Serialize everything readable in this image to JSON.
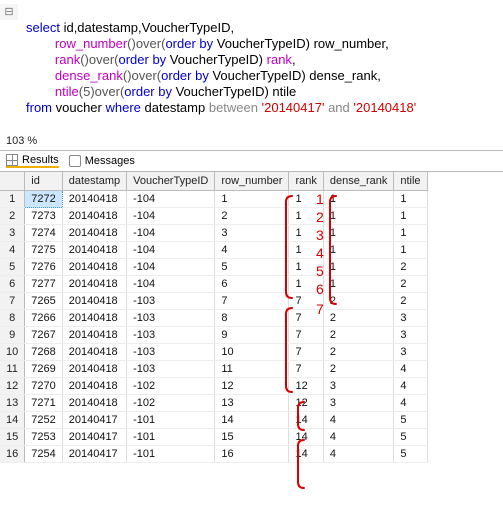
{
  "editor": {
    "toggle": "⊟",
    "line1_a": "select",
    "line1_b": " id,datestamp,VoucherTypeID,",
    "line2_a": "        ",
    "line2_b": "row_number",
    "line2_c": "()over(",
    "line2_d": "order by",
    "line2_e": " VoucherTypeID) row_number,",
    "line3_a": "        ",
    "line3_b": "rank",
    "line3_c": "()over(",
    "line3_d": "order by",
    "line3_e": " VoucherTypeID) ",
    "line3_f": "rank",
    "line3_g": ",",
    "line4_a": "        ",
    "line4_b": "dense_rank",
    "line4_c": "()over(",
    "line4_d": "order by",
    "line4_e": " VoucherTypeID) dense_rank,",
    "line5_a": "        ",
    "line5_b": "ntile",
    "line5_c": "(5)over(",
    "line5_d": "order by",
    "line5_e": " VoucherTypeID) ntile",
    "line6_a": "from",
    "line6_b": " voucher ",
    "line6_c": "where",
    "line6_d": " datestamp ",
    "line6_e": "between",
    "line6_f": " ",
    "line6_g": "'20140417'",
    "line6_h": " ",
    "line6_i": "and",
    "line6_j": " ",
    "line6_k": "'20140418'"
  },
  "zoom": "103 %",
  "tabs": {
    "results": "Results",
    "messages": "Messages"
  },
  "columns": [
    "",
    "id",
    "datestamp",
    "VoucherTypeID",
    "row_number",
    "rank",
    "dense_rank",
    "ntile"
  ],
  "rows": [
    {
      "n": "1",
      "id": "7272",
      "ds": "20140418",
      "vt": "-104",
      "rn": "1",
      "rk": "1",
      "dr": "1",
      "nt": "1"
    },
    {
      "n": "2",
      "id": "7273",
      "ds": "20140418",
      "vt": "-104",
      "rn": "2",
      "rk": "1",
      "dr": "1",
      "nt": "1"
    },
    {
      "n": "3",
      "id": "7274",
      "ds": "20140418",
      "vt": "-104",
      "rn": "3",
      "rk": "1",
      "dr": "1",
      "nt": "1"
    },
    {
      "n": "4",
      "id": "7275",
      "ds": "20140418",
      "vt": "-104",
      "rn": "4",
      "rk": "1",
      "dr": "1",
      "nt": "1"
    },
    {
      "n": "5",
      "id": "7276",
      "ds": "20140418",
      "vt": "-104",
      "rn": "5",
      "rk": "1",
      "dr": "1",
      "nt": "2"
    },
    {
      "n": "6",
      "id": "7277",
      "ds": "20140418",
      "vt": "-104",
      "rn": "6",
      "rk": "1",
      "dr": "1",
      "nt": "2"
    },
    {
      "n": "7",
      "id": "7265",
      "ds": "20140418",
      "vt": "-103",
      "rn": "7",
      "rk": "7",
      "dr": "2",
      "nt": "2"
    },
    {
      "n": "8",
      "id": "7266",
      "ds": "20140418",
      "vt": "-103",
      "rn": "8",
      "rk": "7",
      "dr": "2",
      "nt": "3"
    },
    {
      "n": "9",
      "id": "7267",
      "ds": "20140418",
      "vt": "-103",
      "rn": "9",
      "rk": "7",
      "dr": "2",
      "nt": "3"
    },
    {
      "n": "10",
      "id": "7268",
      "ds": "20140418",
      "vt": "-103",
      "rn": "10",
      "rk": "7",
      "dr": "2",
      "nt": "3"
    },
    {
      "n": "11",
      "id": "7269",
      "ds": "20140418",
      "vt": "-103",
      "rn": "11",
      "rk": "7",
      "dr": "2",
      "nt": "4"
    },
    {
      "n": "12",
      "id": "7270",
      "ds": "20140418",
      "vt": "-102",
      "rn": "12",
      "rk": "12",
      "dr": "3",
      "nt": "4"
    },
    {
      "n": "13",
      "id": "7271",
      "ds": "20140418",
      "vt": "-102",
      "rn": "13",
      "rk": "12",
      "dr": "3",
      "nt": "4"
    },
    {
      "n": "14",
      "id": "7252",
      "ds": "20140417",
      "vt": "-101",
      "rn": "14",
      "rk": "14",
      "dr": "4",
      "nt": "5"
    },
    {
      "n": "15",
      "id": "7253",
      "ds": "20140417",
      "vt": "-101",
      "rn": "15",
      "rk": "14",
      "dr": "4",
      "nt": "5"
    },
    {
      "n": "16",
      "id": "7254",
      "ds": "20140417",
      "vt": "-101",
      "rn": "16",
      "rk": "14",
      "dr": "4",
      "nt": "5"
    }
  ],
  "handwriting": [
    "1",
    "2",
    "3",
    "4",
    "5",
    "6",
    "7"
  ]
}
